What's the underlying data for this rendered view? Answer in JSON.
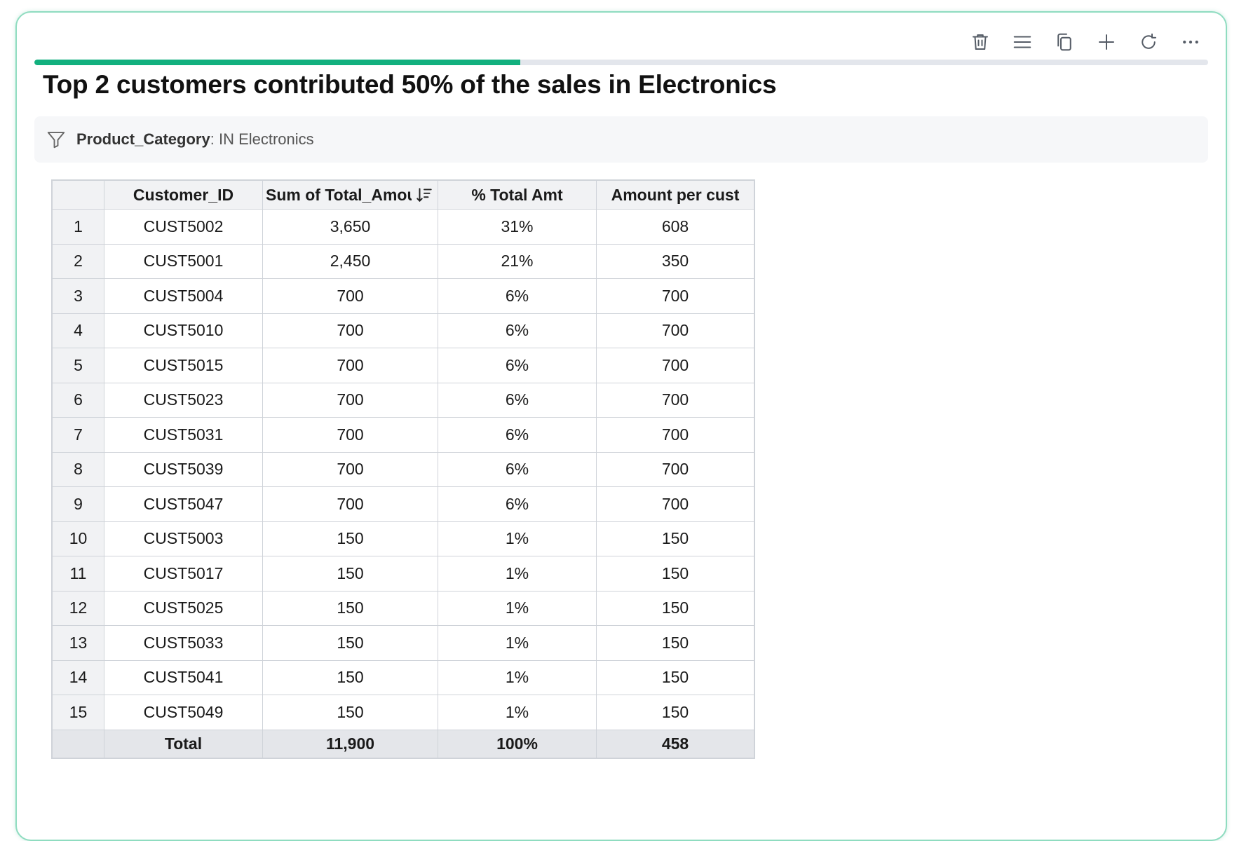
{
  "toolbar": {
    "items": [
      {
        "name": "delete",
        "icon": "trash-icon"
      },
      {
        "name": "menu",
        "icon": "hamburger-menu-icon"
      },
      {
        "name": "copy",
        "icon": "copy-icon"
      },
      {
        "name": "add",
        "icon": "plus-icon"
      },
      {
        "name": "refresh",
        "icon": "refresh-icon"
      },
      {
        "name": "more",
        "icon": "more-horizontal-icon"
      }
    ]
  },
  "progress": {
    "fraction": 0.414,
    "color": "#12b07e"
  },
  "title": "Top 2 customers contributed 50% of the sales in Electronics",
  "filter": {
    "icon": "filter-icon",
    "field": "Product_Category",
    "separator": ":",
    "value": " IN Electronics"
  },
  "table": {
    "columns": [
      "",
      "Customer_ID",
      "Sum of Total_Amount",
      "% Total Amt",
      "Amount per cust"
    ],
    "sort_icon": "sort-descending-icon",
    "rows": [
      {
        "idx": "1",
        "id": "CUST5002",
        "sum": "3,650",
        "pct": "31%",
        "per": "608"
      },
      {
        "idx": "2",
        "id": "CUST5001",
        "sum": "2,450",
        "pct": "21%",
        "per": "350"
      },
      {
        "idx": "3",
        "id": "CUST5004",
        "sum": "700",
        "pct": "6%",
        "per": "700"
      },
      {
        "idx": "4",
        "id": "CUST5010",
        "sum": "700",
        "pct": "6%",
        "per": "700"
      },
      {
        "idx": "5",
        "id": "CUST5015",
        "sum": "700",
        "pct": "6%",
        "per": "700"
      },
      {
        "idx": "6",
        "id": "CUST5023",
        "sum": "700",
        "pct": "6%",
        "per": "700"
      },
      {
        "idx": "7",
        "id": "CUST5031",
        "sum": "700",
        "pct": "6%",
        "per": "700"
      },
      {
        "idx": "8",
        "id": "CUST5039",
        "sum": "700",
        "pct": "6%",
        "per": "700"
      },
      {
        "idx": "9",
        "id": "CUST5047",
        "sum": "700",
        "pct": "6%",
        "per": "700"
      },
      {
        "idx": "10",
        "id": "CUST5003",
        "sum": "150",
        "pct": "1%",
        "per": "150"
      },
      {
        "idx": "11",
        "id": "CUST5017",
        "sum": "150",
        "pct": "1%",
        "per": "150"
      },
      {
        "idx": "12",
        "id": "CUST5025",
        "sum": "150",
        "pct": "1%",
        "per": "150"
      },
      {
        "idx": "13",
        "id": "CUST5033",
        "sum": "150",
        "pct": "1%",
        "per": "150"
      },
      {
        "idx": "14",
        "id": "CUST5041",
        "sum": "150",
        "pct": "1%",
        "per": "150"
      },
      {
        "idx": "15",
        "id": "CUST5049",
        "sum": "150",
        "pct": "1%",
        "per": "150"
      }
    ],
    "total": {
      "label": "Total",
      "sum": "11,900",
      "pct": "100%",
      "per": "458"
    }
  }
}
